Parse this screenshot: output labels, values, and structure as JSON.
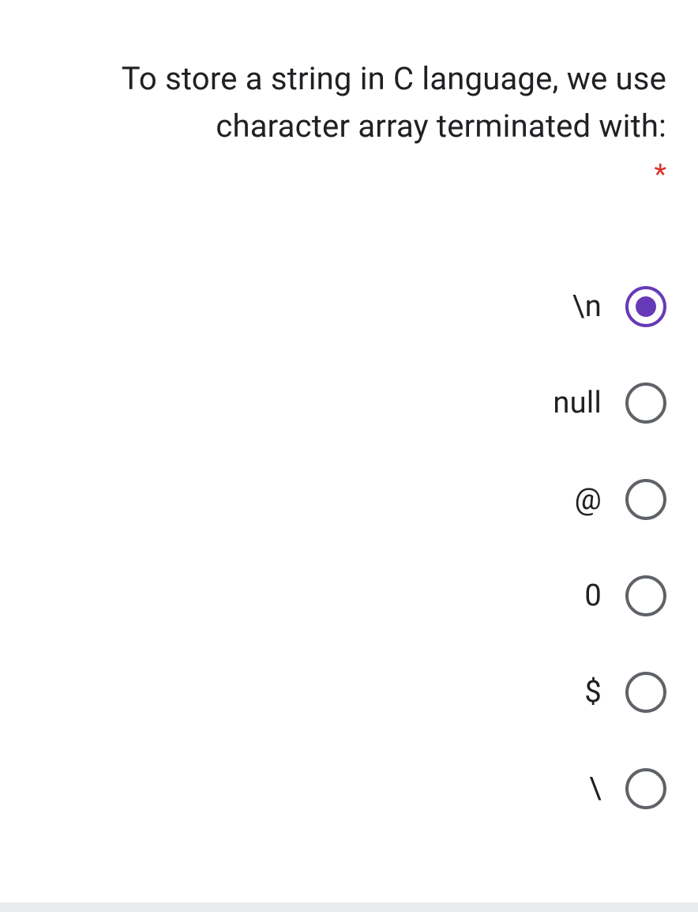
{
  "question": {
    "text": "To store a string in C language, we use character array terminated with:",
    "required_mark": "*"
  },
  "options": [
    {
      "label": "\\n",
      "selected": true
    },
    {
      "label": "null",
      "selected": false
    },
    {
      "label": "@",
      "selected": false
    },
    {
      "label": "0",
      "selected": false
    },
    {
      "label": "$",
      "selected": false
    },
    {
      "label": "\\",
      "selected": false
    }
  ]
}
